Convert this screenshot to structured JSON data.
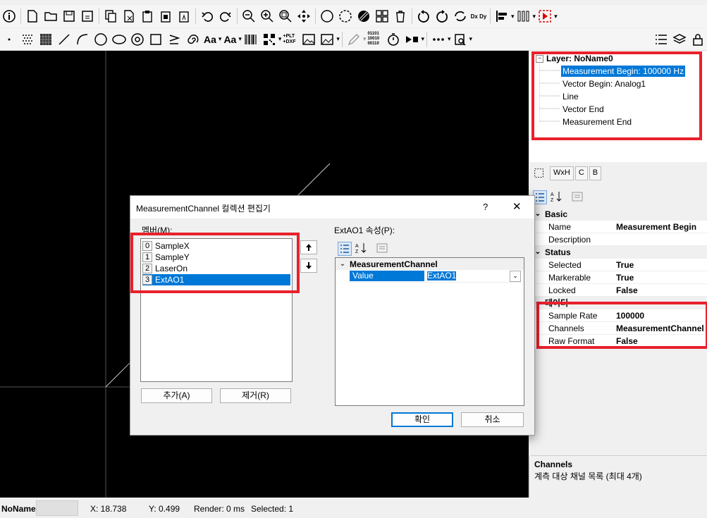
{
  "canvas": {
    "background": "#000000"
  },
  "tree": {
    "root": "Layer: NoName0",
    "items": [
      "Measurement Begin: 100000 Hz",
      "Vector Begin: Analog1",
      "Line",
      "Vector End",
      "Measurement End"
    ],
    "selected_index": 0
  },
  "property_toolbar": {
    "wxh": "WxH",
    "c": "C",
    "b": "B"
  },
  "property_grid": {
    "categories": [
      {
        "name": "Basic",
        "rows": [
          {
            "name": "Name",
            "value": "Measurement Begin"
          },
          {
            "name": "Description",
            "value": ""
          }
        ]
      },
      {
        "name": "Status",
        "rows": [
          {
            "name": "Selected",
            "value": "True"
          },
          {
            "name": "Markerable",
            "value": "True"
          },
          {
            "name": "Locked",
            "value": "False"
          }
        ]
      },
      {
        "name": "데이터",
        "rows": [
          {
            "name": "Sample Rate",
            "value": "100000"
          },
          {
            "name": "Channels",
            "value": "MeasurementChannel"
          },
          {
            "name": "Raw Format",
            "value": "False"
          }
        ]
      }
    ]
  },
  "description": {
    "title": "Channels",
    "text": "계측 대상 채널 목록 (최대 4개)"
  },
  "status_bar": {
    "doc": "NoName",
    "x": "X: 18.738",
    "y": "Y: 0.499",
    "render": "Render: 0 ms",
    "selected": "Selected: 1"
  },
  "toolbar": {
    "font_label": "Aa",
    "font_label_bold": "Aa",
    "plt_dxf": "+PLT +DXF",
    "binary": "01101 10010 00110",
    "dxdy": "Dx Dy"
  },
  "dialog": {
    "title": "MeasurementChannel 컬렉션 편집기",
    "help": "?",
    "close": "✕",
    "members_label": "멤버(M):",
    "members": [
      {
        "index": "0",
        "name": "SampleX"
      },
      {
        "index": "1",
        "name": "SampleY"
      },
      {
        "index": "2",
        "name": "LaserOn"
      },
      {
        "index": "3",
        "name": "ExtAO1"
      }
    ],
    "selected_member": 3,
    "add_button": "추가(A)",
    "remove_button": "제거(R)",
    "props_label": "ExtAO1 속성(P):",
    "prop_category": "MeasurementChannel",
    "prop_name": "Value",
    "prop_value": "ExtAO1",
    "ok_button": "확인",
    "cancel_button": "취소"
  },
  "colors": {
    "highlight": "#e8212c",
    "selection": "#0078d7"
  }
}
